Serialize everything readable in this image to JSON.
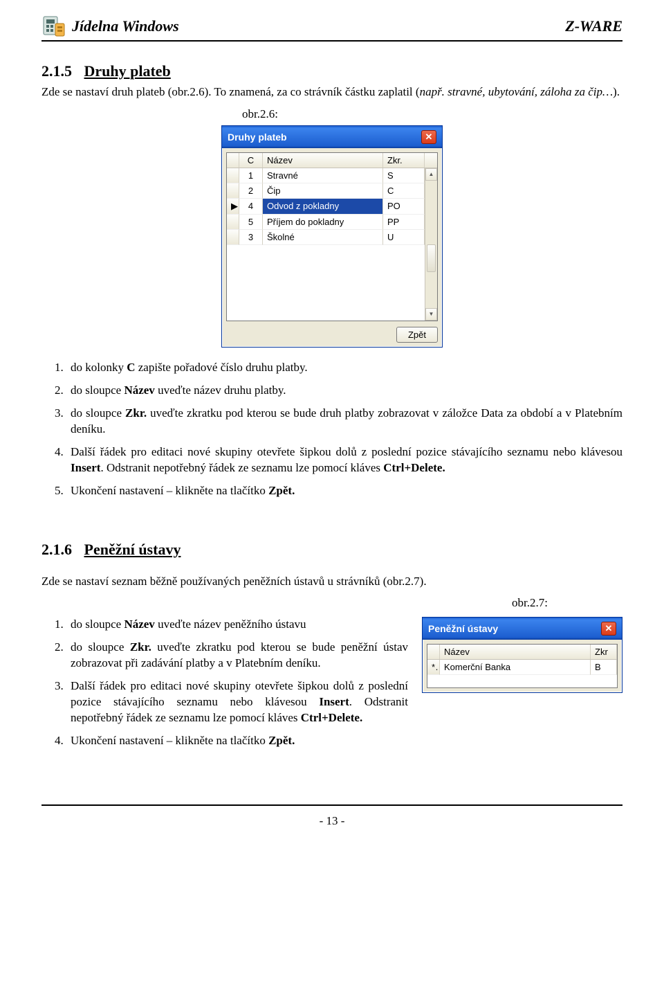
{
  "header": {
    "app_title": "Jídelna Windows",
    "brand": "Z-WARE"
  },
  "section1": {
    "number": "2.1.5",
    "title": "Druhy plateb",
    "intro_pre": "Zde se nastaví druh plateb (obr.2.6). To znamená, za co strávník částku zaplatil (",
    "intro_em": "např. stravné, ubytování, záloha za čip…",
    "intro_post": ").",
    "fig_label": "obr.2.6:"
  },
  "dialog1": {
    "title": "Druhy plateb",
    "headers": {
      "c": "C",
      "nazev": "Název",
      "zkr": "Zkr."
    },
    "rows": [
      {
        "c": "1",
        "nazev": "Stravné",
        "zkr": "S",
        "selected": false,
        "marker": ""
      },
      {
        "c": "2",
        "nazev": "Čip",
        "zkr": "C",
        "selected": false,
        "marker": ""
      },
      {
        "c": "4",
        "nazev": "Odvod z pokladny",
        "zkr": "PO",
        "selected": true,
        "marker": "▶"
      },
      {
        "c": "5",
        "nazev": "Příjem do pokladny",
        "zkr": "PP",
        "selected": false,
        "marker": ""
      },
      {
        "c": "3",
        "nazev": "Školné",
        "zkr": "U",
        "selected": false,
        "marker": ""
      }
    ],
    "back_button": "Zpět"
  },
  "steps1": {
    "items": [
      {
        "pre": "do kolonky ",
        "b1": "C",
        "post1": " zapište pořadové číslo druhu platby."
      },
      {
        "pre": "do sloupce ",
        "b1": "Název",
        "post1": " uveďte název druhu platby."
      },
      {
        "pre": "do sloupce ",
        "b1": "Zkr.",
        "post1": " uveďte zkratku pod kterou se bude druh platby zobrazovat v záložce Data za období a v Platebním deníku."
      },
      {
        "pre": "Další řádek pro editaci nové skupiny otevřete šipkou dolů z poslední pozice stávajícího seznamu nebo klávesou ",
        "b1": "Insert",
        "post1": ". Odstranit nepotřebný řádek ze seznamu lze pomocí kláves ",
        "b2": "Ctrl+Delete.",
        "post2": ""
      },
      {
        "pre": "Ukončení nastavení – klikněte na tlačítko ",
        "b1": "Zpět.",
        "post1": ""
      }
    ]
  },
  "section2": {
    "number": "2.1.6",
    "title": "Peněžní ústavy",
    "intro": "Zde se nastaví seznam běžně používaných peněžních ústavů u strávníků (obr.2.7).",
    "fig_label": "obr.2.7:"
  },
  "dialog2": {
    "title": "Peněžní ústavy",
    "headers": {
      "nazev": "Název",
      "zkr": "Zkr"
    },
    "rows": [
      {
        "marker": "*",
        "nazev": "Komerční Banka",
        "zkr": "B"
      }
    ]
  },
  "steps2": {
    "items": [
      {
        "pre": "do sloupce ",
        "b1": "Název",
        "post1": " uveďte název peněžního ústavu"
      },
      {
        "pre": "do sloupce ",
        "b1": "Zkr.",
        "post1": " uveďte zkratku pod kterou se bude peněžní ústav zobrazovat při zadávání platby a v Platebním deníku."
      },
      {
        "pre": "Další řádek pro editaci nové skupiny otevřete šipkou dolů z poslední pozice stávajícího seznamu nebo klávesou ",
        "b1": "Insert",
        "post1": ". Odstranit nepotřebný řádek ze seznamu lze pomocí kláves ",
        "b2": "Ctrl+Delete.",
        "post2": ""
      },
      {
        "pre": "Ukončení nastavení – klikněte na tlačítko ",
        "b1": "Zpět.",
        "post1": ""
      }
    ]
  },
  "footer": {
    "pagenum": "- 13 -"
  }
}
